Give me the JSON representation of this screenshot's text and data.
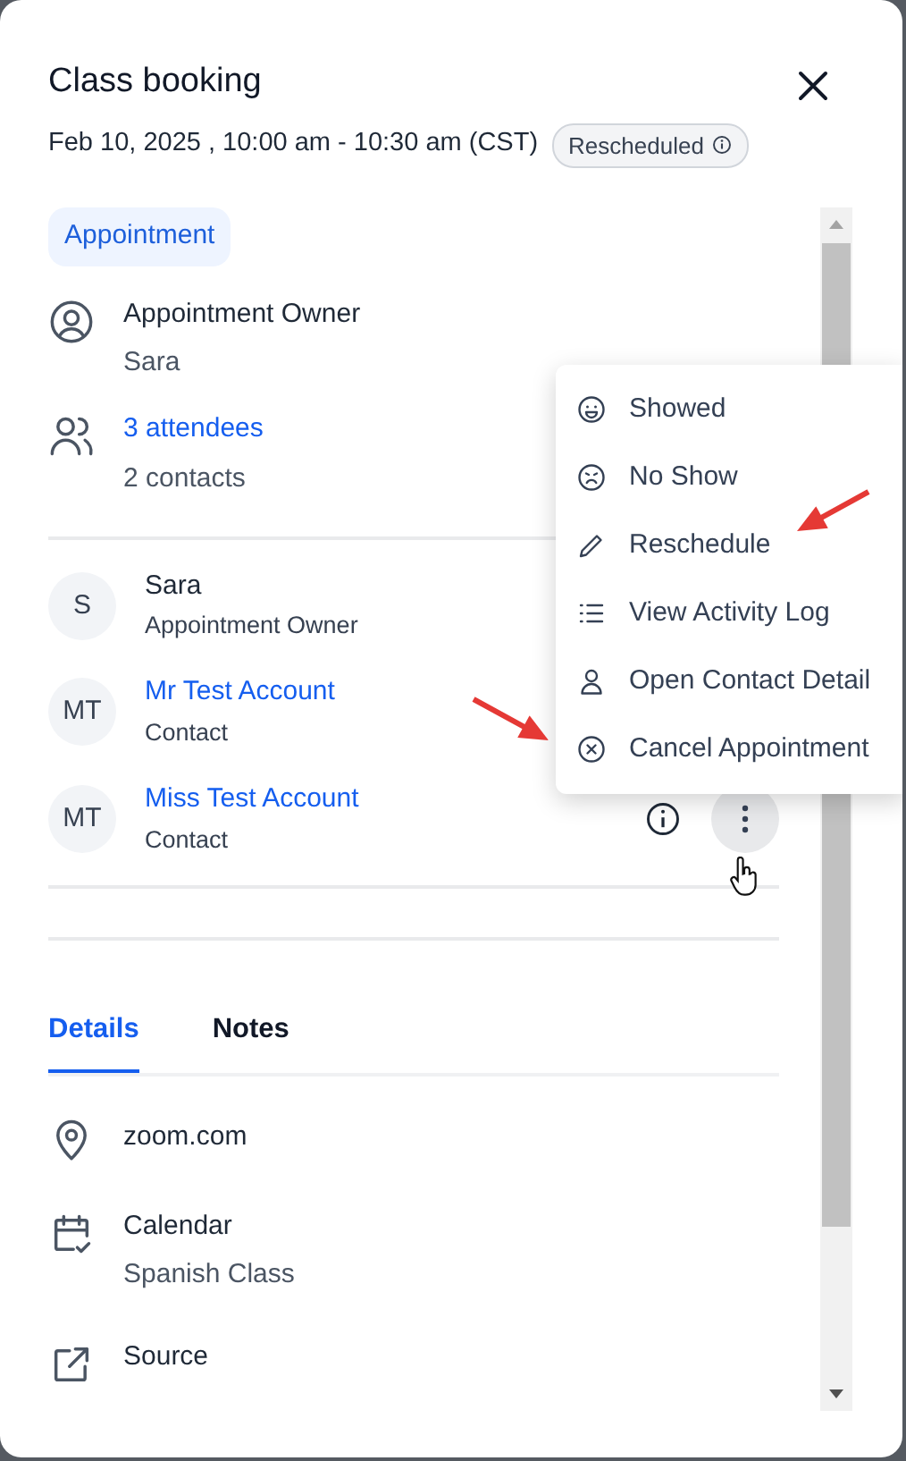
{
  "title": "Class booking",
  "date_time": "Feb 10, 2025 , 10:00 am - 10:30 am (CST)",
  "status_badge": {
    "label": "Rescheduled"
  },
  "type_tag": "Appointment",
  "owner": {
    "label": "Appointment Owner",
    "name": "Sara"
  },
  "attendees": {
    "link": "3 attendees",
    "summary": "2 contacts"
  },
  "participants": [
    {
      "initials": "S",
      "name": "Sara",
      "role": "Appointment Owner",
      "kind": "owner",
      "show_actions": false
    },
    {
      "initials": "MT",
      "name": "Mr Test Account",
      "role": "Contact",
      "kind": "contact",
      "show_actions": false
    },
    {
      "initials": "MT",
      "name": "Miss Test Account",
      "role": "Contact",
      "kind": "contact",
      "show_actions": true
    }
  ],
  "tabs": [
    {
      "label": "Details",
      "selected": true
    },
    {
      "label": "Notes",
      "selected": false
    }
  ],
  "details": [
    {
      "kind": "location",
      "value": "zoom.com"
    },
    {
      "kind": "calendar",
      "label": "Calendar",
      "value": "Spanish Class"
    },
    {
      "kind": "source",
      "label": "Source"
    }
  ],
  "menu": [
    {
      "kind": "smile",
      "label": "Showed"
    },
    {
      "kind": "frown",
      "label": "No Show"
    },
    {
      "kind": "pencil",
      "label": "Reschedule"
    },
    {
      "kind": "list",
      "label": "View Activity Log"
    },
    {
      "kind": "person",
      "label": "Open Contact Detail"
    },
    {
      "kind": "cancel",
      "label": "Cancel Appointment"
    }
  ]
}
